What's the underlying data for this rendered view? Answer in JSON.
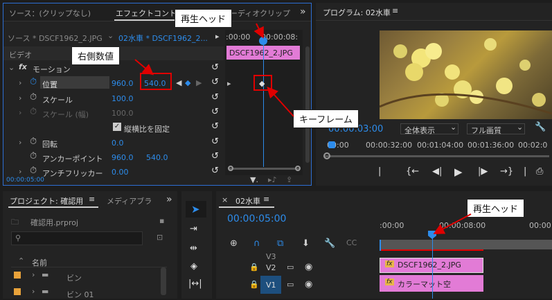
{
  "effect_panel": {
    "tabs": [
      "ソース：(クリップなし)",
      "エフェクトコント",
      "オーディオクリップ"
    ],
    "more": "»",
    "source_clip": "ソース * DSCF1962_2.JPG",
    "seq_clip": "02水車 * DSCF1962_2...",
    "ruler_left": ":00:00",
    "ruler_right": "00:00:08:",
    "clip_bar": "DSCF1962_2.JPG",
    "section_video": "ビデオ",
    "fx_motion": "モーション",
    "position_label": "位置",
    "position_x": "960.0",
    "position_y": "540.0",
    "scale_label": "スケール",
    "scale_value": "100.0",
    "scale_w_label": "スケール (幅)",
    "scale_w_value": "100.0",
    "uniform_label": "縦横比を固定",
    "rotation_label": "回転",
    "rotation_value": "0.0",
    "anchor_label": "アンカーポイント",
    "anchor_x": "960.0",
    "anchor_y": "540.0",
    "flicker_label": "アンチフリッカー",
    "flicker_value": "0.00",
    "timecode": "00:00:05:00"
  },
  "program": {
    "title": "プログラム: 02水車",
    "menu": "≡",
    "timecode": "00:00:03:00",
    "zoom": "全体表示",
    "quality": "フル画質",
    "ruler": [
      "00:00",
      "00:00:32:00",
      "00:01:04:00",
      "00:01:36:00",
      "00:02:0"
    ]
  },
  "project": {
    "tab1": "プロジェクト: 確認用",
    "menu": "≡",
    "tab2": "メディアブラ",
    "more": "»",
    "file": "確認用.prproj",
    "search_placeholder": "",
    "col_name": "名前",
    "items": [
      "ビン",
      "ビン 01"
    ]
  },
  "timeline": {
    "close": "×",
    "title": "02水車",
    "menu": "≡",
    "timecode": "00:00:05:00",
    "ruler_left": ":00:00",
    "ruler_mid": "00:00:08:00",
    "ruler_right": "00:00",
    "tracks": [
      "V3",
      "V2",
      "V1"
    ],
    "clip_v2": "DSCF1962_2.JPG",
    "clip_v1": "カラーマット空"
  },
  "annotations": {
    "playhead_top": "再生ヘッド",
    "right_value": "右側数値",
    "keyframe": "キーフレーム",
    "playhead_bottom": "再生ヘッド"
  }
}
